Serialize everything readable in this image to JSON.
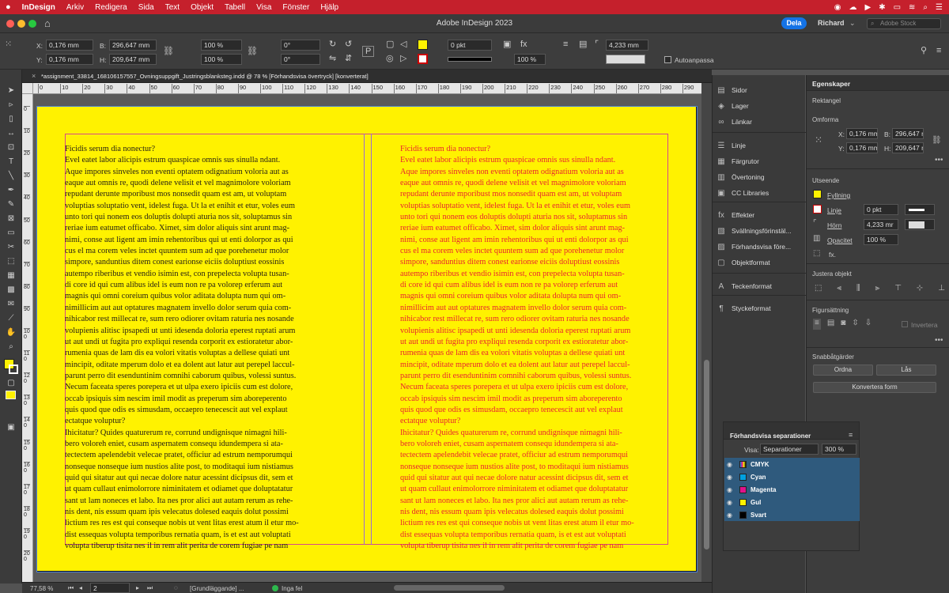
{
  "menubar": {
    "items": [
      "InDesign",
      "Arkiv",
      "Redigera",
      "Sida",
      "Text",
      "Objekt",
      "Tabell",
      "Visa",
      "Fönster",
      "Hjälp"
    ],
    "brand_color": "#c5202c"
  },
  "titlebar": {
    "title": "Adobe InDesign 2023",
    "share_label": "Dela",
    "user": "Richard",
    "stock_placeholder": "Adobe Stock"
  },
  "control": {
    "x": "0,176 mm",
    "y": "0,176 mm",
    "w": "296,647 mm",
    "h": "209,647 mm",
    "scale_x": "100 %",
    "scale_y": "100 %",
    "angle": "0°",
    "shear": "0°",
    "stroke_weight": "0 pkt",
    "opacity": "100 %",
    "corner": "4,233 mm",
    "autofit": "Autoanpassa",
    "x_label": "X:",
    "y_label": "Y:",
    "w_label": "B:",
    "h_label": "H:"
  },
  "document": {
    "tab_title": "*assignment_33814_168106157557_Ovningsuppgift_Justringsblanksteg.indd @ 78 % [Förhandsvisa övertryck] [konverterat]",
    "page_color": "#fff200"
  },
  "ruler": {
    "h_ticks": [
      "0",
      "10",
      "20",
      "30",
      "40",
      "50",
      "60",
      "70",
      "80",
      "90",
      "100",
      "110",
      "120",
      "130",
      "140",
      "150",
      "160",
      "170",
      "180",
      "190",
      "200",
      "210",
      "220",
      "230",
      "240",
      "250",
      "260",
      "270",
      "280",
      "290"
    ],
    "v_ticks": [
      "0",
      "10",
      "20",
      "30",
      "40",
      "50",
      "60",
      "70",
      "80",
      "90",
      "100",
      "110",
      "120",
      "130",
      "140",
      "150",
      "160",
      "170",
      "180",
      "190",
      "200"
    ]
  },
  "text_lines": [
    "Ficidis serum dia nonectur?",
    "Evel eatet labor alicipis estrum quaspicae omnis sus sinulla ndant.",
    "Aque impores sinveles non eventi optatem odignatium voloria aut as",
    "eaque aut omnis re, quodi delene velisit et vel magnimolore voloriam",
    "repudant derunte mporibust mos nonsedit quam est am, ut voluptam",
    "voluptias soluptatio vent, idelest fuga. Ut la et enihit et etur, voles eum",
    "unto tori qui nonem eos doluptis dolupti aturia nos sit, soluptamus sin",
    "reriae ium eatumet officabo. Ximet, sim dolor aliquis sint arunt mag-",
    "nimi, conse aut ligent am imin rehentoribus qui ut enti dolorpor as qui",
    "cus el ma corem veles inctet quuntem sum ad que porehenetur molor",
    "simpore, sanduntius ditem conest earionse eiciis doluptiust eossinis",
    "autempo riberibus et vendio isimin est, con prepelecta volupta tusan-",
    "di core id qui cum alibus idel is eum non re pa volorep erferum aut",
    "magnis qui omni coreium quibus volor aditata dolupta num qui om-",
    "nimillicim aut aut optatures magnatem invello dolor serum quia com-",
    "nihicabor rest millecat re, sum rero odiorer ovitam raturia nes nosande",
    "volupienis alitisc ipsapedi ut unti idesenda doloria eperest ruptati arum",
    "ut aut undi ut fugita pro expliqui resenda corporit ex estioratetur abor-",
    "rumenia quas de lam dis ea volori vitatis voluptas a dellese quiati unt",
    "mincipit, oditate mperum dolo et ea dolent aut latur aut perepel laccul-",
    "parunt perro dit esenduntinim comnihi caborum quibus, volessi suntus.",
    "Necum faceata speres porepera et ut ulpa exero ipiciis cum est dolore,",
    "occab ipsiquis sim nescim imil modit as preperum sim aboreperento",
    "quis quod que odis es simusdam, occaepro tenecescit aut vel explaut",
    "ectatque voluptur?",
    "Ihicitatur? Quides quaturerum re, corrund undignisque nimagni hili-",
    "bero voloreh eniet, cusam aspernatem consequ idundempera si ata-",
    "tectectem apelendebit velecae pratet, officiur ad estrum nemporumqui",
    "nonseque nonseque ium nustios alite post, to moditaqui ium nistiamus",
    "quid qui sitatur aut qui necae dolore natur acessint dicipsus dit, sem et",
    "ut quam cullaut enimolorrore niminitatem et odiamet que doluptatatur",
    "sant ut lam noneces et labo. Ita nes pror alici aut autam rerum as rehe-",
    "nis dent, nis essum quam ipis velecatus dolesed eaquis dolut possimi",
    "lictium res res est qui conseque nobis ut vent litas erest atum il etur mo-",
    "dist essequas volupta temporibus rernatia quam, is et est aut voluptati",
    "volupta tiberup tisita nes il in rem alit perita de corem fugiae pe nam"
  ],
  "toolbar_icons": [
    "selection-icon",
    "direct-selection-icon",
    "page-tool-icon",
    "gap-tool-icon",
    "content-collector-icon",
    "type-icon",
    "line-icon",
    "pen-icon",
    "pencil-icon",
    "rectangle-frame-icon",
    "rectangle-icon",
    "scissors-icon",
    "free-transform-icon",
    "gradient-swatch-icon",
    "gradient-feather-icon",
    "note-icon",
    "eyedropper-icon",
    "hand-icon",
    "zoom-icon"
  ],
  "panels_dock": [
    {
      "icon": "pages-icon",
      "label": "Sidor"
    },
    {
      "icon": "layers-icon",
      "label": "Lager"
    },
    {
      "icon": "links-icon",
      "label": "Länkar"
    },
    {
      "icon": "stroke-icon",
      "label": "Linje"
    },
    {
      "icon": "swatches-icon",
      "label": "Färgrutor"
    },
    {
      "icon": "gradient-icon",
      "label": "Övertoning"
    },
    {
      "icon": "cc-libraries-icon",
      "label": "CC Libraries"
    },
    {
      "icon": "effects-icon",
      "label": "Effekter"
    },
    {
      "icon": "flattener-preview-icon",
      "label": "Svällningsförinstäl..."
    },
    {
      "icon": "overprint-preview-icon",
      "label": "Förhandsvisa före..."
    },
    {
      "icon": "object-styles-icon",
      "label": "Objektformat"
    },
    {
      "icon": "character-styles-icon",
      "label": "Teckenformat"
    },
    {
      "icon": "paragraph-styles-icon",
      "label": "Styckeformat"
    }
  ],
  "properties": {
    "tab": "Egenskaper",
    "object_type": "Rektangel",
    "transform_title": "Omforma",
    "x": "0,176 mm",
    "y": "0,176 mm",
    "w": "296,647 r",
    "h": "209,647 r",
    "x_label": "X:",
    "y_label": "Y:",
    "w_label": "B:",
    "h_label": "H:",
    "appearance_title": "Utseende",
    "fill_label": "Fyllning",
    "stroke_label": "Linje",
    "stroke_weight": "0 pkt",
    "corner_label": "Hörn",
    "corner_value": "4,233 mr",
    "opacity_label": "Opacitet",
    "opacity_value": "100 %",
    "fx_label": "fx.",
    "align_title": "Justera objekt",
    "wrap_title": "Figursättning",
    "invert_label": "Invertera",
    "quick_title": "Snabbåtgärder",
    "arrange_button": "Ordna",
    "lock_button": "Lås",
    "convert_button": "Konvertera form",
    "fill_color": "#fff200"
  },
  "separations": {
    "title": "Förhandsvisa separationer",
    "view_label": "Visa:",
    "view_value": "Separationer",
    "zoom_value": "300 %",
    "rows": [
      {
        "name": "CMYK",
        "color": "#7a7a7a"
      },
      {
        "name": "Cyan",
        "color": "#00a0e0"
      },
      {
        "name": "Magenta",
        "color": "#e0128c"
      },
      {
        "name": "Gul",
        "color": "#fff200"
      },
      {
        "name": "Svart",
        "color": "#000000"
      }
    ]
  },
  "status": {
    "zoom": "77,58 %",
    "page": "2",
    "style": "[Grundläggande] ...",
    "preflight": "Inga fel"
  }
}
